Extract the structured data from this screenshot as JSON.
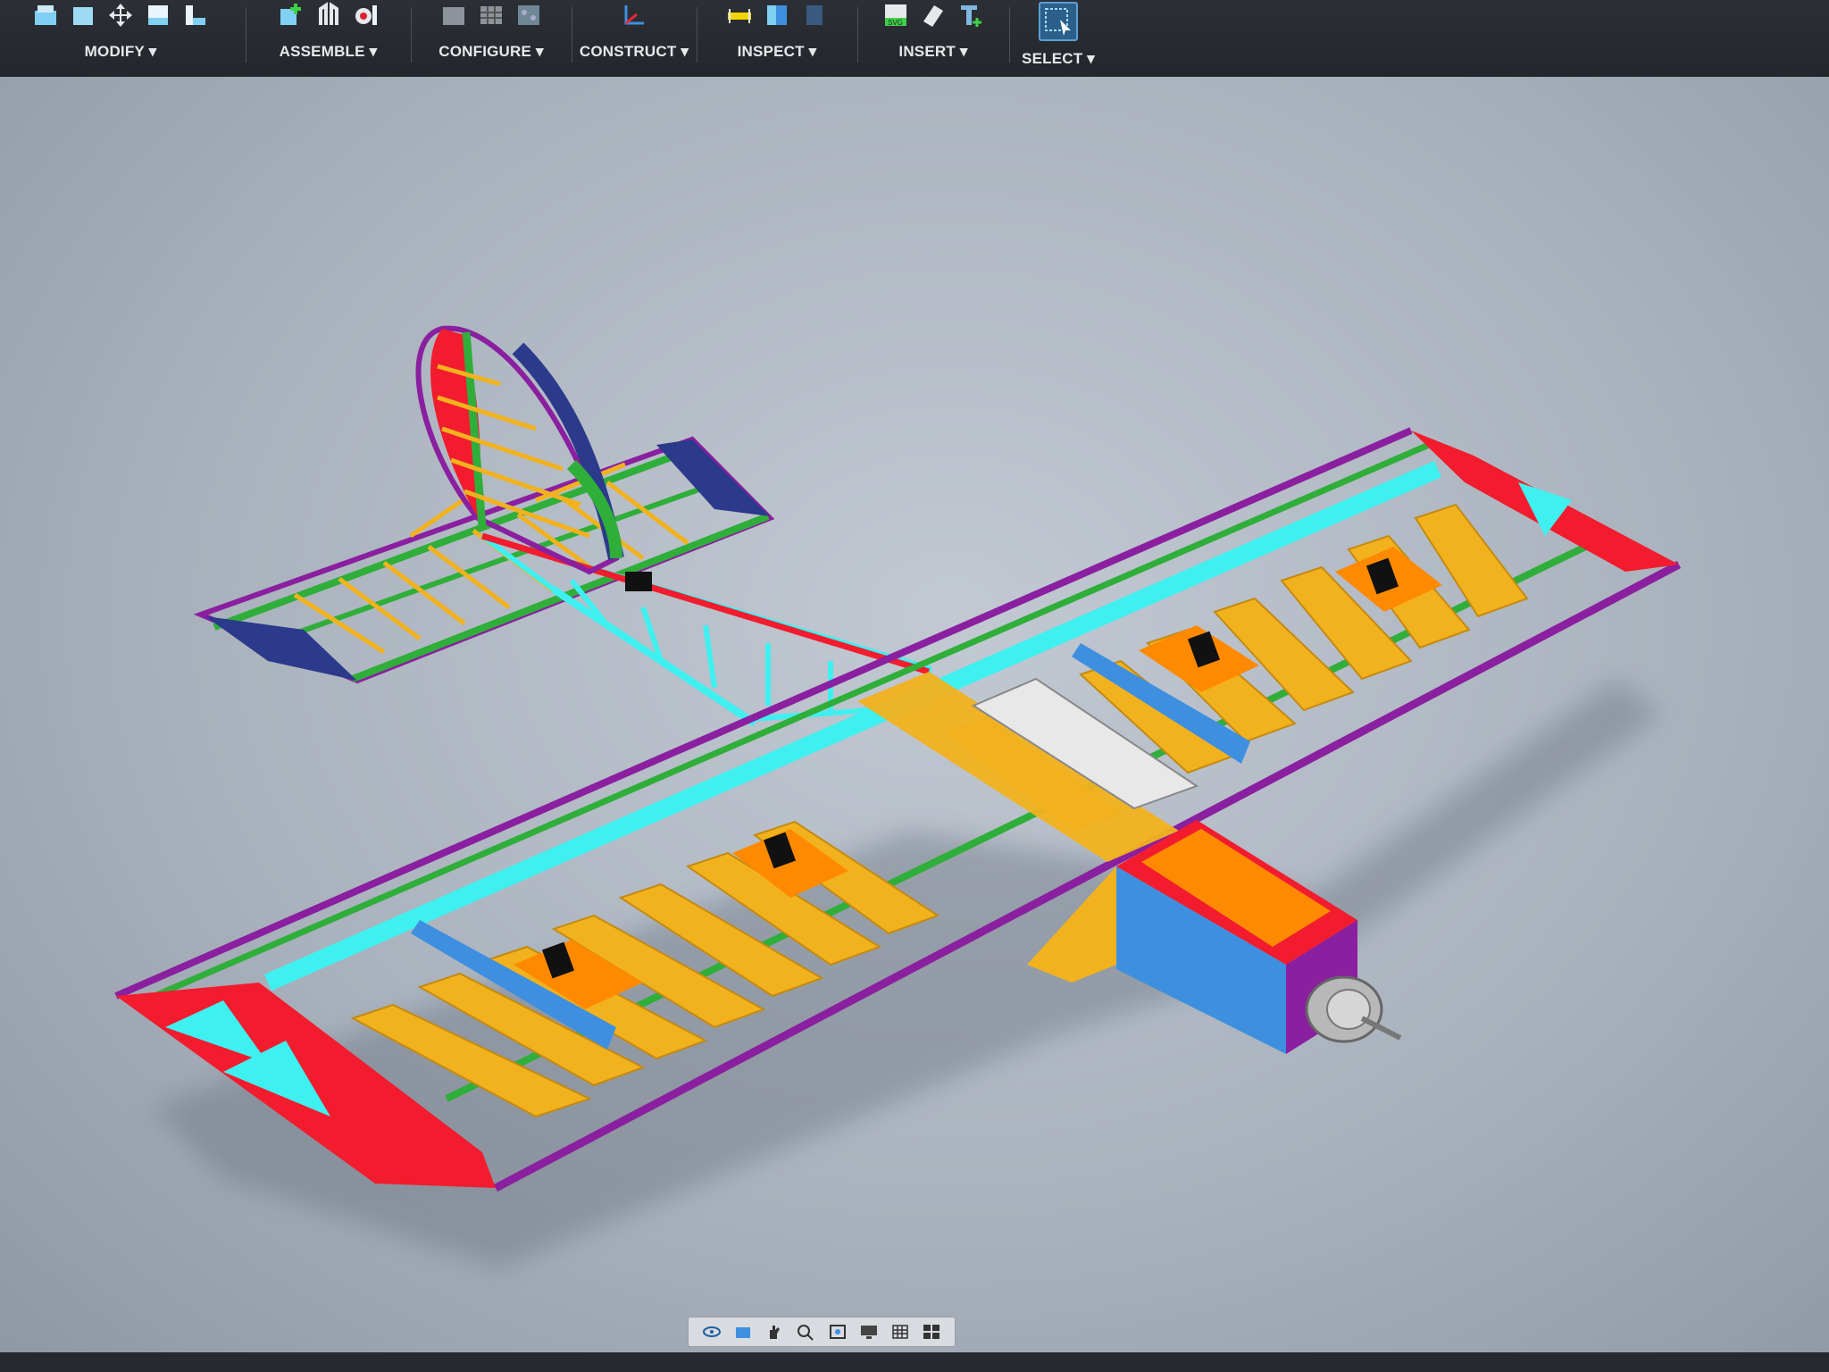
{
  "toolbar": {
    "groups": [
      {
        "label": "MODIFY",
        "icons": [
          "press-pull-icon",
          "fillet-icon",
          "move-icon",
          "align-icon",
          "split-icon"
        ]
      },
      {
        "label": "ASSEMBLE",
        "icons": [
          "new-component-icon",
          "joint-icon",
          "motion-icon"
        ]
      },
      {
        "label": "CONFIGURE",
        "icons": [
          "configure-table-icon",
          "configure-grid-icon",
          "configure-flow-icon"
        ]
      },
      {
        "label": "CONSTRUCT",
        "icons": [
          "axis-plane-icon"
        ]
      },
      {
        "label": "INSPECT",
        "icons": [
          "measure-icon",
          "section-analysis-icon",
          "zebra-icon"
        ]
      },
      {
        "label": "INSERT",
        "icons": [
          "insert-svg-icon",
          "insert-decal-icon",
          "insert-text-icon"
        ]
      },
      {
        "label": "SELECT",
        "icons": [
          "select-window-icon"
        ]
      }
    ],
    "svg_badge": "SVG",
    "dropdown_marker": "▾"
  },
  "viewport": {
    "model": "rc-airplane-frame-assembly",
    "colors": {
      "rib": "#f2b21e",
      "spar": "#2fae3a",
      "leading_edge": "#3ff0f0",
      "trailing_edge": "#8a1fa0",
      "wingtip": "#f21c2e",
      "servo_plate": "#ff8a00",
      "fuselage": "#3f8fe0",
      "motor_mount": "#ff7a00",
      "tail_plate": "#2b3a8a",
      "motor": "#b8b8b8"
    }
  },
  "navbar": {
    "icons": [
      "orbit-icon",
      "look-at-icon",
      "pan-icon",
      "zoom-icon",
      "fit-icon",
      "display-settings-icon",
      "grid-icon",
      "viewports-icon"
    ]
  }
}
